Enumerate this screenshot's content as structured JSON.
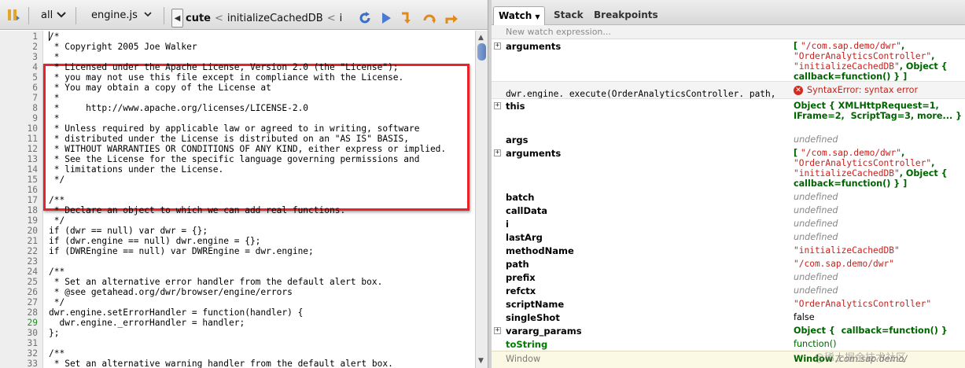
{
  "toolbar": {
    "scope_label": "all",
    "file_label": "engine.js",
    "crumbs": [
      "cute",
      "initializeCachedDB",
      "i"
    ]
  },
  "code": {
    "lines": [
      {
        "n": "1",
        "text": "/*"
      },
      {
        "n": "2",
        "text": " * Copyright 2005 Joe Walker"
      },
      {
        "n": "3",
        "text": " *"
      },
      {
        "n": "4",
        "text": " * Licensed under the Apache License, Version 2.0 (the \"License\");"
      },
      {
        "n": "5",
        "text": " * you may not use this file except in compliance with the License."
      },
      {
        "n": "6",
        "text": " * You may obtain a copy of the License at"
      },
      {
        "n": "7",
        "text": " *"
      },
      {
        "n": "8",
        "text": " *     http://www.apache.org/licenses/LICENSE-2.0"
      },
      {
        "n": "9",
        "text": " *"
      },
      {
        "n": "10",
        "text": " * Unless required by applicable law or agreed to in writing, software"
      },
      {
        "n": "11",
        "text": " * distributed under the License is distributed on an \"AS IS\" BASIS,"
      },
      {
        "n": "12",
        "text": " * WITHOUT WARRANTIES OR CONDITIONS OF ANY KIND, either express or implied."
      },
      {
        "n": "13",
        "text": " * See the License for the specific language governing permissions and"
      },
      {
        "n": "14",
        "text": " * limitations under the License."
      },
      {
        "n": "15",
        "text": " */"
      },
      {
        "n": "16",
        "text": ""
      },
      {
        "n": "17",
        "text": "/**"
      },
      {
        "n": "18",
        "text": " * Declare an object to which we can add real functions."
      },
      {
        "n": "19",
        "text": " */"
      },
      {
        "n": "20",
        "text": "if (dwr == null) var dwr = {};"
      },
      {
        "n": "21",
        "text": "if (dwr.engine == null) dwr.engine = {};"
      },
      {
        "n": "22",
        "text": "if (DWREngine == null) var DWREngine = dwr.engine;"
      },
      {
        "n": "23",
        "text": ""
      },
      {
        "n": "24",
        "text": "/**"
      },
      {
        "n": "25",
        "text": " * Set an alternative error handler from the default alert box."
      },
      {
        "n": "26",
        "text": " * @see getahead.org/dwr/browser/engine/errors"
      },
      {
        "n": "27",
        "text": " */"
      },
      {
        "n": "28",
        "text": "dwr.engine.setErrorHandler = function(handler) {"
      },
      {
        "n": "29",
        "text": "  dwr.engine._errorHandler = handler;"
      },
      {
        "n": "30",
        "text": "};"
      },
      {
        "n": "31",
        "text": ""
      },
      {
        "n": "32",
        "text": "/**"
      },
      {
        "n": "33",
        "text": " * Set an alternative warning handler from the default alert box."
      }
    ]
  },
  "panel": {
    "tabs": [
      "Watch",
      "Stack",
      "Breakpoints"
    ],
    "new_watch_placeholder": "New watch expression...",
    "error_text": "SyntaxError: syntax error",
    "window_name": "Window",
    "window_value": "Window",
    "window_tail": "/com.sap.demo/",
    "rows": [
      {
        "name": "arguments",
        "kind": "watch",
        "value": "[ \"/com.sap.demo/dwr\", \"OrderAnalyticsController\", \"initializeCachedDB\", Object { callback=function() } ]"
      },
      {
        "name": "dwr.engine._execute(OrderAnalyticsController._path,",
        "kind": "expr"
      },
      {
        "name": "this",
        "value": "Object { XMLHttpRequest=1, IFrame=2,  ScriptTag=3, more... }"
      },
      {
        "name": "args",
        "value": "undefined"
      },
      {
        "name": "arguments",
        "value": "[ \"/com.sap.demo/dwr\", \"OrderAnalyticsController\", \"initializeCachedDB\", Object { callback=function() } ]"
      },
      {
        "name": "batch",
        "value": "undefined"
      },
      {
        "name": "callData",
        "value": "undefined"
      },
      {
        "name": "i",
        "value": "undefined"
      },
      {
        "name": "lastArg",
        "value": "undefined"
      },
      {
        "name": "methodName",
        "value": "\"initializeCachedDB\""
      },
      {
        "name": "path",
        "value": "\"/com.sap.demo/dwr\""
      },
      {
        "name": "prefix",
        "value": "undefined"
      },
      {
        "name": "refctx",
        "value": "undefined"
      },
      {
        "name": "scriptName",
        "value": "\"OrderAnalyticsController\""
      },
      {
        "name": "singleShot",
        "value": "false"
      },
      {
        "name": "vararg_params",
        "value": "Object {  callback=function() }"
      },
      {
        "name": "toString",
        "value": "function()"
      }
    ]
  },
  "watermark": "@稀土掘金技术社区",
  "colors": {
    "highlight_border": "#e8232a",
    "string_value": "#c8211c",
    "object_value": "#006400",
    "undefined_value": "#888888"
  }
}
